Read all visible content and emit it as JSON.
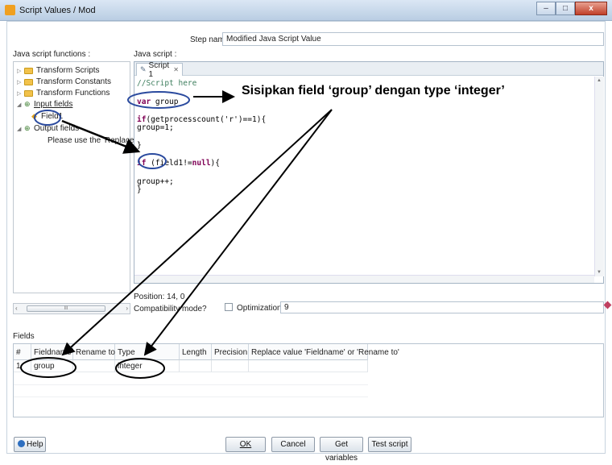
{
  "window": {
    "title": "Script Values / Mod",
    "buttons": {
      "minimize": "–",
      "maximize": "□",
      "close": "x"
    }
  },
  "step_name": {
    "label": "Step name",
    "value": "Modified Java Script Value"
  },
  "functions_panel": {
    "label": "Java script functions :",
    "items": [
      {
        "label": "Transform Scripts"
      },
      {
        "label": "Transform Constants"
      },
      {
        "label": "Transform Functions"
      },
      {
        "label": "Input fields"
      },
      {
        "label": "Field1"
      },
      {
        "label": "Output fields"
      },
      {
        "label": "Please use the 'Replace value 'Field"
      }
    ],
    "scroll_thumb": "III"
  },
  "editor": {
    "label": "Java script :",
    "tab_label": "Script 1",
    "tab_close": "✕",
    "lines": {
      "l1": "//Script here",
      "l2_kw": "var",
      "l2": " group",
      "l3_kw": "if",
      "l3": "(getprocesscount('r')==1){",
      "l4": "group=1;",
      "l5": "}",
      "l6_kw": "if",
      "l6a": " (field1!=",
      "l6_kw2": "null",
      "l6b": "){",
      "l7": "group++;",
      "l8": "}"
    }
  },
  "position": "Position: 14, 0",
  "compatibility_mode": "Compatibility mode?",
  "optimization": {
    "label": "Optimization level",
    "value": "9"
  },
  "fields_table": {
    "label": "Fields",
    "columns": [
      "#",
      "Fieldname",
      "Rename to",
      "Type",
      "Length",
      "Precision",
      "Replace value 'Fieldname' or 'Rename to'"
    ],
    "rows": [
      {
        "num": "1",
        "fieldname": "group",
        "rename": "",
        "type": "integer",
        "length": "",
        "precision": "",
        "replace": ""
      }
    ]
  },
  "buttons": {
    "help": "Help",
    "ok": "OK",
    "cancel": "Cancel",
    "get_variables": "Get variables",
    "test_script": "Test script"
  },
  "annotation": "Sisipkan field ‘group’ dengan type ‘integer’"
}
